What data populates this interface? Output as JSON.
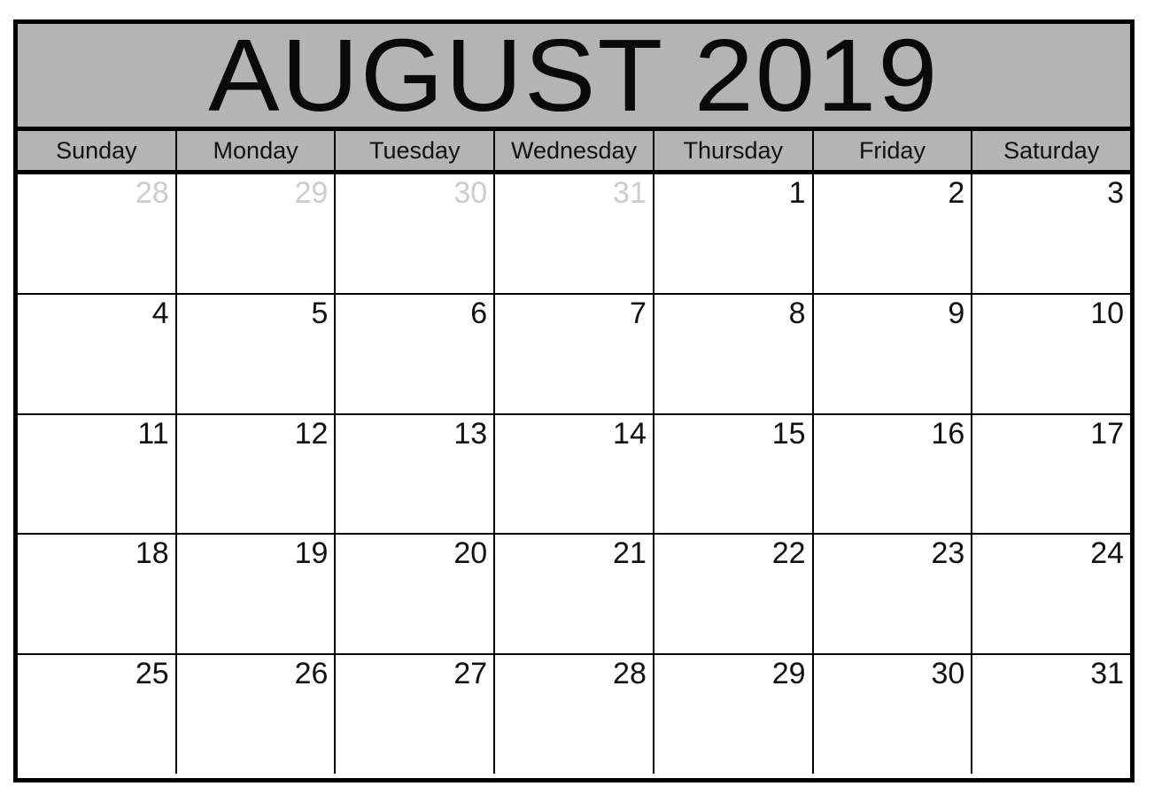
{
  "calendar": {
    "title": "AUGUST 2019",
    "month": "AUGUST",
    "year": "2019",
    "colors": {
      "header_background": "#b4b4b4",
      "border": "#000000",
      "cell_background": "#ffffff",
      "day_text": "#111111",
      "other_month_day_text": "#cccccc"
    },
    "weekdays": [
      {
        "label": "Sunday"
      },
      {
        "label": "Monday"
      },
      {
        "label": "Tuesday"
      },
      {
        "label": "Wednesday"
      },
      {
        "label": "Thursday"
      },
      {
        "label": "Friday"
      },
      {
        "label": "Saturday"
      }
    ],
    "weeks": [
      {
        "days": [
          {
            "number": "28",
            "in_month": false
          },
          {
            "number": "29",
            "in_month": false
          },
          {
            "number": "30",
            "in_month": false
          },
          {
            "number": "31",
            "in_month": false
          },
          {
            "number": "1",
            "in_month": true
          },
          {
            "number": "2",
            "in_month": true
          },
          {
            "number": "3",
            "in_month": true
          }
        ]
      },
      {
        "days": [
          {
            "number": "4",
            "in_month": true
          },
          {
            "number": "5",
            "in_month": true
          },
          {
            "number": "6",
            "in_month": true
          },
          {
            "number": "7",
            "in_month": true
          },
          {
            "number": "8",
            "in_month": true
          },
          {
            "number": "9",
            "in_month": true
          },
          {
            "number": "10",
            "in_month": true
          }
        ]
      },
      {
        "days": [
          {
            "number": "11",
            "in_month": true
          },
          {
            "number": "12",
            "in_month": true
          },
          {
            "number": "13",
            "in_month": true
          },
          {
            "number": "14",
            "in_month": true
          },
          {
            "number": "15",
            "in_month": true
          },
          {
            "number": "16",
            "in_month": true
          },
          {
            "number": "17",
            "in_month": true
          }
        ]
      },
      {
        "days": [
          {
            "number": "18",
            "in_month": true
          },
          {
            "number": "19",
            "in_month": true
          },
          {
            "number": "20",
            "in_month": true
          },
          {
            "number": "21",
            "in_month": true
          },
          {
            "number": "22",
            "in_month": true
          },
          {
            "number": "23",
            "in_month": true
          },
          {
            "number": "24",
            "in_month": true
          }
        ]
      },
      {
        "days": [
          {
            "number": "25",
            "in_month": true
          },
          {
            "number": "26",
            "in_month": true
          },
          {
            "number": "27",
            "in_month": true
          },
          {
            "number": "28",
            "in_month": true
          },
          {
            "number": "29",
            "in_month": true
          },
          {
            "number": "30",
            "in_month": true
          },
          {
            "number": "31",
            "in_month": true
          }
        ]
      }
    ]
  }
}
